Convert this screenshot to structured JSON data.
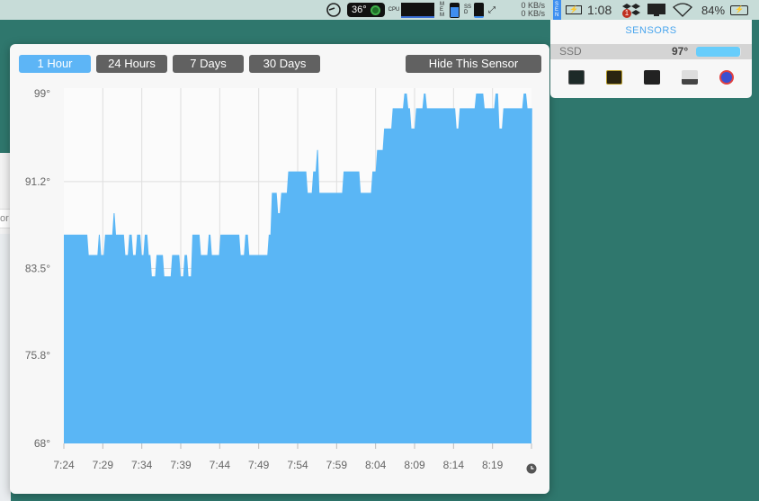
{
  "menubar": {
    "temp_badge": "36°",
    "cpu_label": "CPU",
    "mem_label": "MEM",
    "ssd_label": "SSD",
    "net_up": "0 KB/s",
    "net_down": "0 KB/s",
    "sen_label": "SEN",
    "time": "1:08",
    "dropbox_badge": "1",
    "battery_percent": "84%",
    "mem_fill": 0.6,
    "icons": [
      "istat-gauge-icon",
      "cpu-graph-icon",
      "mem-bar-icon",
      "ssd-bar-icon",
      "network-arrows-icon",
      "battery-small-icon",
      "dropbox-icon",
      "display-icon",
      "wifi-icon",
      "battery-charging-icon"
    ]
  },
  "left_window": {
    "text": "or"
  },
  "popover": {
    "range_buttons": [
      {
        "label": "1 Hour",
        "active": true
      },
      {
        "label": "24 Hours",
        "active": false
      },
      {
        "label": "7 Days",
        "active": false
      },
      {
        "label": "30 Days",
        "active": false
      }
    ],
    "hide_button": "Hide This Sensor",
    "clock_icon": "clock-icon"
  },
  "chart_data": {
    "type": "area",
    "color": "#5ab6f5",
    "y_ticks": [
      "99°",
      "91.2°",
      "83.5°",
      "75.8°",
      "68°"
    ],
    "ylim": [
      68,
      99
    ],
    "x_ticks": [
      "7:24",
      "7:29",
      "7:34",
      "7:39",
      "7:44",
      "7:49",
      "7:54",
      "7:59",
      "8:04",
      "8:09",
      "8:14",
      "8:19"
    ],
    "xlim": [
      "7:24:00",
      "8:24:00"
    ],
    "grid": true,
    "series": [
      {
        "step_points": [
          [
            "7:24:00",
            86.5
          ],
          [
            "7:27:06",
            84.7
          ],
          [
            "7:28:24",
            86.5
          ],
          [
            "7:28:42",
            84.7
          ],
          [
            "7:29:12",
            86.5
          ],
          [
            "7:30:18",
            88.4
          ],
          [
            "7:30:36",
            86.5
          ],
          [
            "7:31:48",
            84.7
          ],
          [
            "7:32:18",
            86.5
          ],
          [
            "7:32:48",
            84.7
          ],
          [
            "7:33:18",
            86.5
          ],
          [
            "7:33:54",
            84.7
          ],
          [
            "7:34:18",
            86.5
          ],
          [
            "7:34:48",
            84.7
          ],
          [
            "7:35:12",
            82.8
          ],
          [
            "7:35:48",
            84.7
          ],
          [
            "7:36:48",
            82.8
          ],
          [
            "7:37:48",
            84.7
          ],
          [
            "7:38:54",
            82.8
          ],
          [
            "7:39:24",
            84.7
          ],
          [
            "7:39:54",
            82.8
          ],
          [
            "7:40:24",
            86.5
          ],
          [
            "7:41:30",
            84.7
          ],
          [
            "7:42:30",
            86.5
          ],
          [
            "7:42:54",
            84.7
          ],
          [
            "7:44:00",
            86.5
          ],
          [
            "7:46:36",
            84.7
          ],
          [
            "7:47:12",
            86.5
          ],
          [
            "7:47:42",
            84.7
          ],
          [
            "7:50:12",
            86.5
          ],
          [
            "7:50:36",
            90.2
          ],
          [
            "7:51:24",
            88.4
          ],
          [
            "7:51:48",
            90.2
          ],
          [
            "7:52:42",
            92.1
          ],
          [
            "7:55:12",
            90.2
          ],
          [
            "7:55:54",
            92.1
          ],
          [
            "7:56:24",
            94.0
          ],
          [
            "7:56:42",
            90.2
          ],
          [
            "7:59:48",
            92.1
          ],
          [
            "8:02:00",
            90.2
          ],
          [
            "8:03:30",
            92.1
          ],
          [
            "8:04:06",
            94.0
          ],
          [
            "8:05:00",
            95.9
          ],
          [
            "8:06:06",
            97.7
          ],
          [
            "8:07:36",
            99.0
          ],
          [
            "8:08:06",
            97.7
          ],
          [
            "8:08:30",
            95.9
          ],
          [
            "8:09:06",
            97.7
          ],
          [
            "8:10:06",
            99.0
          ],
          [
            "8:10:30",
            97.7
          ],
          [
            "8:14:18",
            95.9
          ],
          [
            "8:14:42",
            97.7
          ],
          [
            "8:16:48",
            99.0
          ],
          [
            "8:17:54",
            97.7
          ],
          [
            "8:19:18",
            99.0
          ],
          [
            "8:19:48",
            95.9
          ],
          [
            "8:20:18",
            97.7
          ],
          [
            "8:22:54",
            99.0
          ],
          [
            "8:23:24",
            97.7
          ],
          [
            "8:24:00",
            97.7
          ]
        ]
      }
    ]
  },
  "sensors_panel": {
    "title": "SENSORS",
    "rows": [
      {
        "name": "SSD",
        "value": "97°",
        "fill": 0.97
      }
    ],
    "app_icons": [
      "activity-monitor-icon",
      "console-icon",
      "terminal-icon",
      "system-information-icon",
      "disk-utility-icon"
    ]
  }
}
